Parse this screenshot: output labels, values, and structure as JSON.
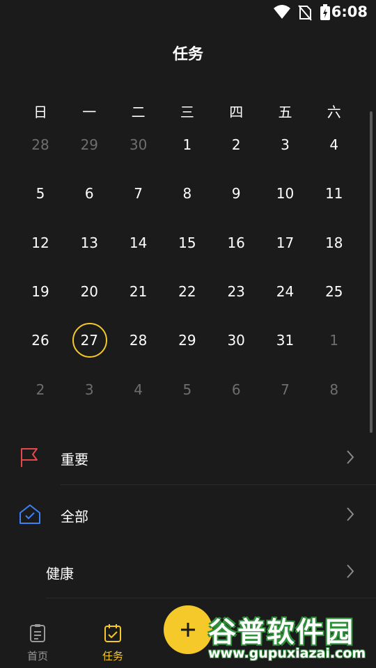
{
  "status_bar": {
    "time": "6:08",
    "icons": [
      "wifi-icon",
      "no-sim-icon",
      "battery-charging-icon"
    ]
  },
  "header": {
    "title": "任务"
  },
  "calendar": {
    "weekdays": [
      "日",
      "一",
      "二",
      "三",
      "四",
      "五",
      "六"
    ],
    "weeks": [
      [
        {
          "d": "28",
          "muted": true
        },
        {
          "d": "29",
          "muted": true
        },
        {
          "d": "30",
          "muted": true
        },
        {
          "d": "1"
        },
        {
          "d": "2"
        },
        {
          "d": "3"
        },
        {
          "d": "4"
        }
      ],
      [
        {
          "d": "5"
        },
        {
          "d": "6"
        },
        {
          "d": "7"
        },
        {
          "d": "8"
        },
        {
          "d": "9"
        },
        {
          "d": "10"
        },
        {
          "d": "11"
        }
      ],
      [
        {
          "d": "12"
        },
        {
          "d": "13"
        },
        {
          "d": "14"
        },
        {
          "d": "15"
        },
        {
          "d": "16"
        },
        {
          "d": "17"
        },
        {
          "d": "18"
        }
      ],
      [
        {
          "d": "19"
        },
        {
          "d": "20"
        },
        {
          "d": "21"
        },
        {
          "d": "22"
        },
        {
          "d": "23"
        },
        {
          "d": "24"
        },
        {
          "d": "25"
        }
      ],
      [
        {
          "d": "26"
        },
        {
          "d": "27",
          "today": true
        },
        {
          "d": "28"
        },
        {
          "d": "29"
        },
        {
          "d": "30"
        },
        {
          "d": "31"
        },
        {
          "d": "1",
          "muted": true
        }
      ],
      [
        {
          "d": "2",
          "muted": true
        },
        {
          "d": "3",
          "muted": true
        },
        {
          "d": "4",
          "muted": true
        },
        {
          "d": "5",
          "muted": true
        },
        {
          "d": "6",
          "muted": true
        },
        {
          "d": "7",
          "muted": true
        },
        {
          "d": "8",
          "muted": true
        }
      ]
    ],
    "today_color": "#f5c929"
  },
  "lists": [
    {
      "label": "重要",
      "icon": "flag-icon",
      "icon_color": "#e5484d"
    },
    {
      "label": "全部",
      "icon": "home-check-icon",
      "icon_color": "#3b82f6"
    },
    {
      "label": "健康",
      "icon": ""
    }
  ],
  "bottom_nav": {
    "items": [
      {
        "label": "首页",
        "icon": "document-icon",
        "active": false
      },
      {
        "label": "任务",
        "icon": "calendar-check-icon",
        "active": true
      }
    ],
    "active_color": "#f5c929",
    "inactive_color": "#9a9a9a",
    "fab_icon": "plus-icon"
  },
  "watermark": {
    "title": "谷普软件园",
    "url": "www.gupuxiazai.com"
  }
}
